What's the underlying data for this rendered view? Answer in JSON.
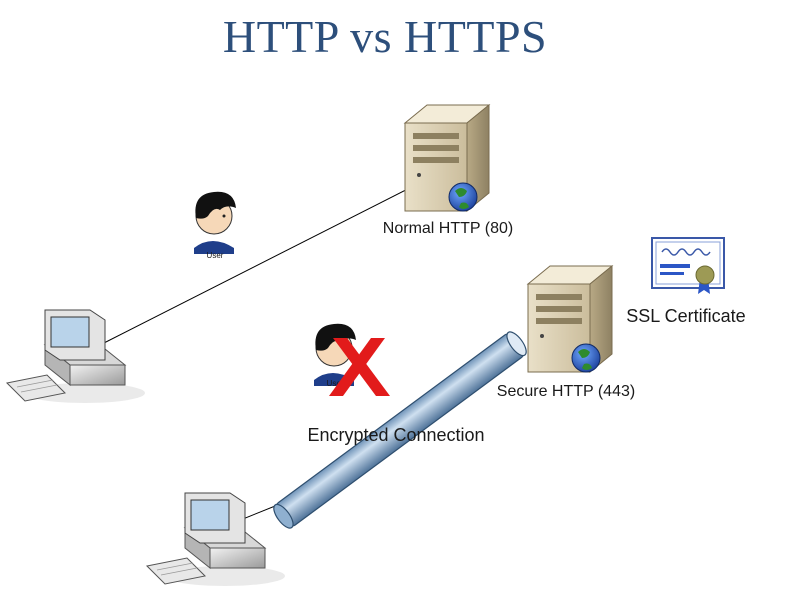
{
  "title": "HTTP vs HTTPS",
  "labels": {
    "normal_server": "Normal HTTP (80)",
    "secure_server": "Secure HTTP (443)",
    "ssl_certificate": "SSL Certificate",
    "encrypted_connection": "Encrypted Connection",
    "user_top": "User",
    "user_blocked": "User"
  },
  "colors": {
    "title": "#2d4f7b",
    "tunnel": "#a9c4dd",
    "block_x": "#e21b1b",
    "ribbon": "#2b56c6"
  }
}
